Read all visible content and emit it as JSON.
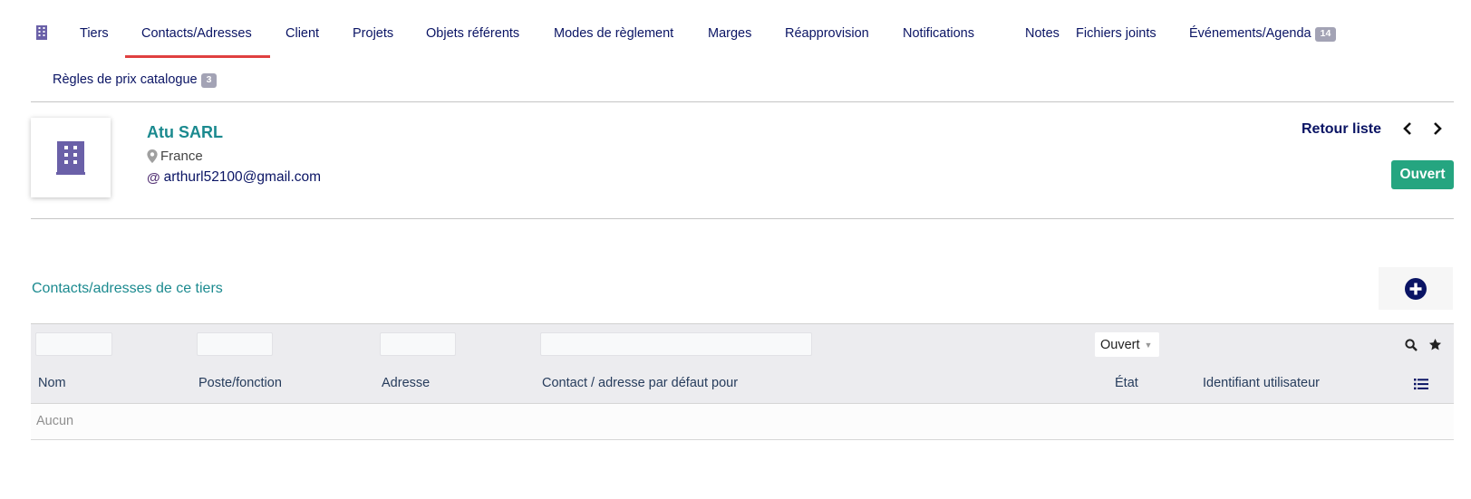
{
  "tabs": [
    {
      "label": "Tiers"
    },
    {
      "label": "Contacts/Adresses",
      "active": true
    },
    {
      "label": "Client"
    },
    {
      "label": "Projets"
    },
    {
      "label": "Objets référents"
    },
    {
      "label": "Modes de règlement"
    },
    {
      "label": "Marges"
    },
    {
      "label": "Réapprovision"
    },
    {
      "label": "Notifications"
    },
    {
      "label": "Notes"
    },
    {
      "label": "Fichiers joints"
    },
    {
      "label": "Événements/Agenda",
      "badge": "14"
    },
    {
      "label": "Règles de prix catalogue",
      "badge": "3"
    }
  ],
  "company": {
    "name": "Atu SARL",
    "country": "France",
    "email": "arthurl52100@gmail.com",
    "status": "Ouvert"
  },
  "nav": {
    "back_label": "Retour liste"
  },
  "section": {
    "title": "Contacts/adresses de ce tiers"
  },
  "table": {
    "filter_status": "Ouvert",
    "columns": [
      "Nom",
      "Poste/fonction",
      "Adresse",
      "Contact / adresse par défaut pour",
      "État",
      "Identifiant utilisateur"
    ],
    "empty_text": "Aucun"
  },
  "colors": {
    "accent_teal": "#1b8a8f",
    "nav_blue": "#0a1464",
    "status_green": "#25a580",
    "active_tab_underline": "#e04040",
    "icon_purple": "#6a60a8"
  },
  "icons": [
    "building-icon",
    "map-marker-icon",
    "at-icon",
    "chevron-left-icon",
    "chevron-right-icon",
    "plus-circle-icon",
    "search-icon",
    "star-icon",
    "list-icon"
  ]
}
